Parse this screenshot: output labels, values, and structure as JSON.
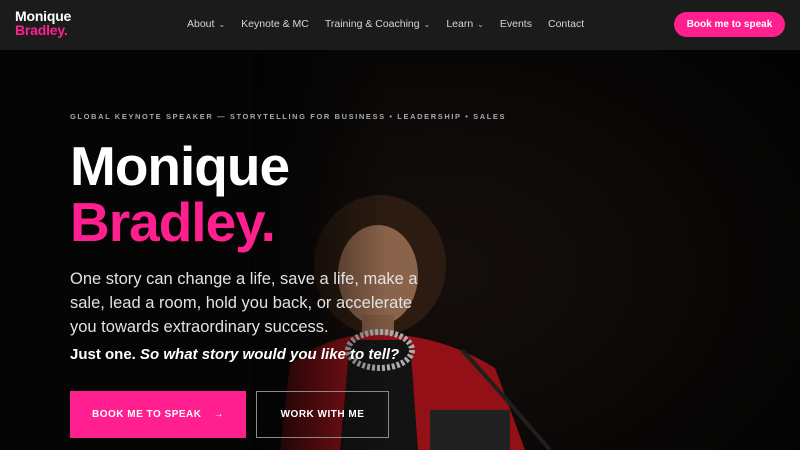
{
  "brand": {
    "line1": "Monique",
    "line2": "Bradley.",
    "accent": "#ff1f8e"
  },
  "nav": {
    "items": [
      {
        "label": "About",
        "has_dropdown": true
      },
      {
        "label": "Keynote & MC",
        "has_dropdown": false
      },
      {
        "label": "Training & Coaching",
        "has_dropdown": true
      },
      {
        "label": "Learn",
        "has_dropdown": true
      },
      {
        "label": "Events",
        "has_dropdown": false
      },
      {
        "label": "Contact",
        "has_dropdown": false
      }
    ],
    "cta_label": "Book me to speak"
  },
  "hero": {
    "eyebrow": "GLOBAL KEYNOTE SPEAKER — STORYTELLING FOR BUSINESS • LEADERSHIP • SALES",
    "title_line1": "Monique",
    "title_line2": "Bradley.",
    "lead": "One story can change a life, save a life, make a sale, lead a room, hold you back, or accelerate you towards extraordinary success.",
    "tag_plain": "Just one.",
    "tag_italic": "So what story would you like to tell?",
    "primary_button": "BOOK ME TO SPEAK",
    "primary_arrow": "→",
    "secondary_button": "WORK WITH ME"
  },
  "icons": {
    "dropdown": "chevron-down-icon",
    "arrow": "arrow-right-icon"
  }
}
